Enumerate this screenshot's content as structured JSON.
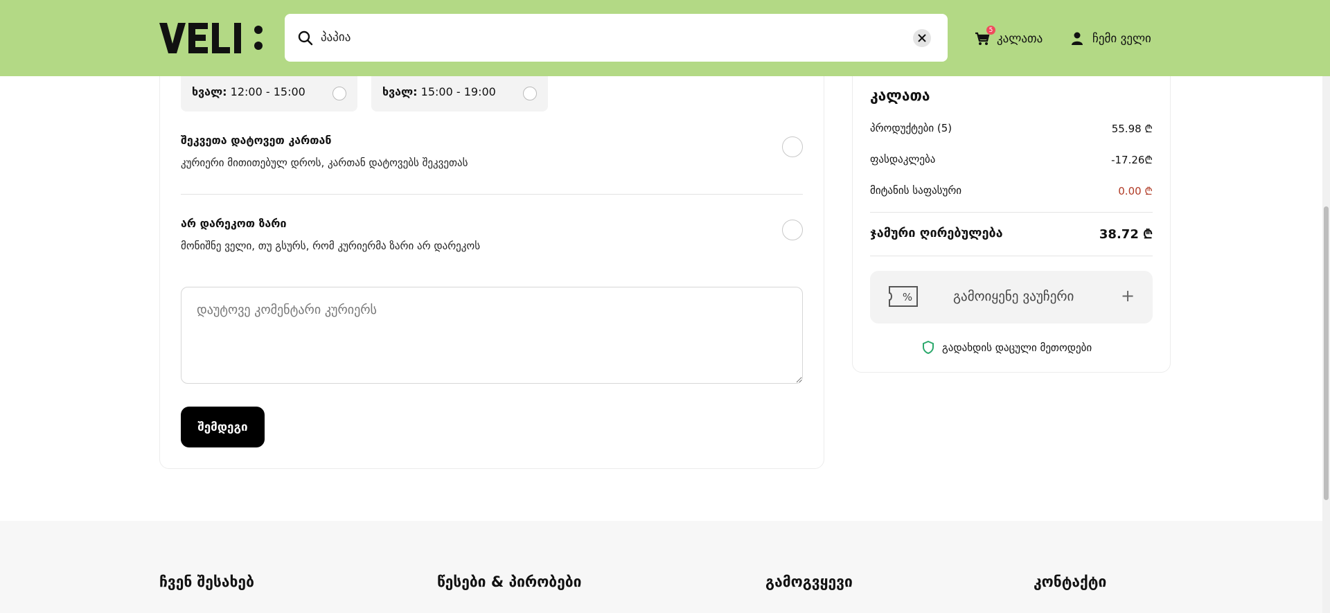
{
  "header": {
    "logo_text": "VELI:",
    "search_value": "პაპია",
    "cart_label": "კალათა",
    "cart_count": "5",
    "account_label": "ჩემი ველი"
  },
  "delivery": {
    "slot1_day": "ხვალ:",
    "slot1_time": "12:00 - 15:00",
    "slot2_day": "ხვალ:",
    "slot2_time": "15:00 - 19:00",
    "option1_title": "შეკვეთა დატოვეთ კართან",
    "option1_desc": "კურიერი მითითებულ დროს, კართან დატოვებს შეკვეთას",
    "option2_title": "არ დარეკოთ ზარი",
    "option2_desc": "მონიშნე ველი, თუ გსურს, რომ კურიერმა ზარი არ დარეკოს",
    "comment_placeholder": "დაუტოვე კომენტარი კურიერს",
    "next_label": "შემდეგი"
  },
  "summary": {
    "title": "კალათა",
    "products_label": "პროდუქტები (5)",
    "products_value": "55.98 ₾",
    "discount_label": "ფასდაკლება",
    "discount_value": "-17.26₾",
    "delivery_label": "მიტანის საფასური",
    "delivery_value": "0.00 ₾",
    "total_label": "ჯამური ღირებულება",
    "total_value": "38.72 ₾",
    "voucher_label": "გამოიყენე ვაუჩერი",
    "voucher_plus": "+",
    "secure_label": "გადახდის დაცული მეთოდები"
  },
  "footer": {
    "about": "ჩვენ შესახებ",
    "terms": "წესები & პირობები",
    "sellers": "გამოგვყევი",
    "contact": "კონტაქტი"
  },
  "colors": {
    "header_bg": "#b3d985",
    "badge": "#ef4b5c",
    "delivery_fee": "#b03a25",
    "shield": "#2aa86b"
  }
}
